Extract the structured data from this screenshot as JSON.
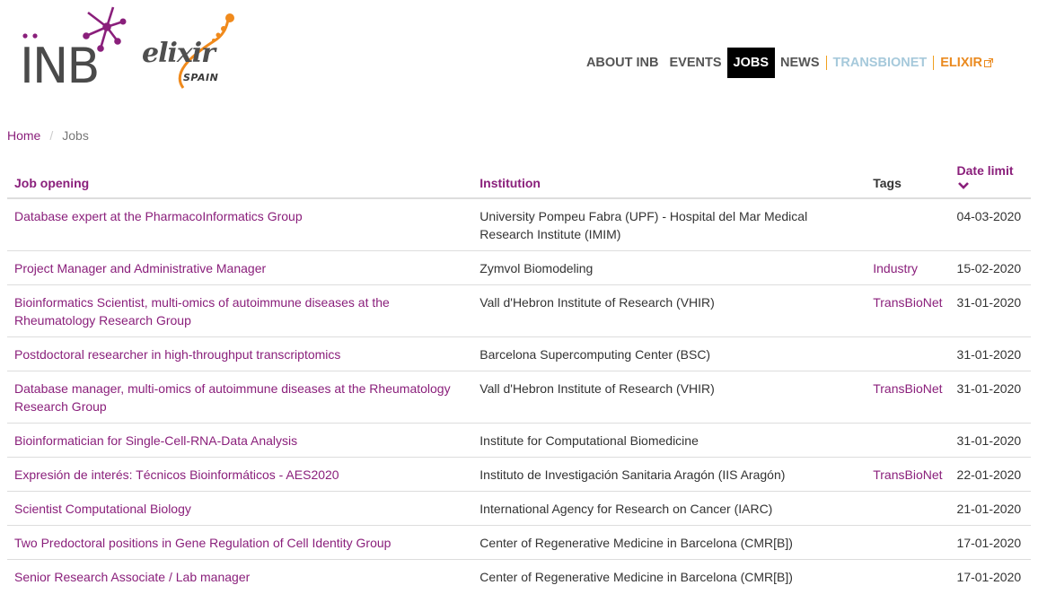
{
  "header": {
    "logo_inb_text": "INB",
    "logo_elixir_text": "elixir",
    "logo_elixir_sub": "SPAIN"
  },
  "nav": {
    "items": [
      {
        "label": "ABOUT INB"
      },
      {
        "label": "EVENTS"
      },
      {
        "label": "JOBS"
      },
      {
        "label": "NEWS"
      },
      {
        "label": "TRANSBIONET"
      },
      {
        "label": "ELIXIR"
      }
    ]
  },
  "breadcrumb": {
    "home": "Home",
    "divider": "/",
    "current": "Jobs"
  },
  "table": {
    "headers": {
      "job": "Job opening",
      "institution": "Institution",
      "tags": "Tags",
      "date": "Date limit"
    },
    "rows": [
      {
        "job": "Database expert at the PharmacoInformatics Group",
        "institution": "University Pompeu Fabra (UPF) - Hospital del Mar Medical Research Institute (IMIM)",
        "tag": "",
        "date": "04-03-2020"
      },
      {
        "job": "Project Manager and Administrative Manager",
        "institution": "Zymvol Biomodeling",
        "tag": "Industry",
        "date": "15-02-2020"
      },
      {
        "job": "Bioinformatics Scientist, multi-omics of autoimmune diseases at the Rheumatology Research Group",
        "institution": "Vall d'Hebron Institute of Research (VHIR)",
        "tag": "TransBioNet",
        "date": "31-01-2020"
      },
      {
        "job": "Postdoctoral researcher in high-throughput transcriptomics",
        "institution": "Barcelona Supercomputing Center (BSC)",
        "tag": "",
        "date": "31-01-2020"
      },
      {
        "job": "Database manager, multi-omics of autoimmune diseases at the Rheumatology Research Group",
        "institution": "Vall d'Hebron Institute of Research (VHIR)",
        "tag": "TransBioNet",
        "date": "31-01-2020"
      },
      {
        "job": "Bioinformatician for Single-Cell-RNA-Data Analysis",
        "institution": "Institute for Computational Biomedicine",
        "tag": "",
        "date": "31-01-2020"
      },
      {
        "job": "Expresión de interés: Técnicos Bioinformáticos - AES2020",
        "institution": "Instituto de Investigación Sanitaria Aragón (IIS Aragón)",
        "tag": "TransBioNet",
        "date": "22-01-2020"
      },
      {
        "job": "Scientist Computational Biology",
        "institution": "International Agency for Research on Cancer (IARC)",
        "tag": "",
        "date": "21-01-2020"
      },
      {
        "job": "Two Predoctoral positions in Gene Regulation of Cell Identity Group",
        "institution": "Center of Regenerative Medicine in Barcelona (CMR[B])",
        "tag": "",
        "date": "17-01-2020"
      },
      {
        "job": "Senior Research Associate / Lab manager",
        "institution": "Center of Regenerative Medicine in Barcelona (CMR[B])",
        "tag": "",
        "date": "17-01-2020"
      }
    ]
  },
  "icons": {
    "sort": "chevron-down-icon",
    "external": "external-link-icon"
  },
  "colors": {
    "link": "#8a1f7b",
    "nav_active_bg": "#000000",
    "transbionet": "#a6c9db",
    "elixir": "#ea8a1f",
    "inb_logo_purple": "#8a1f7b",
    "elixir_orange": "#f08a1c"
  }
}
